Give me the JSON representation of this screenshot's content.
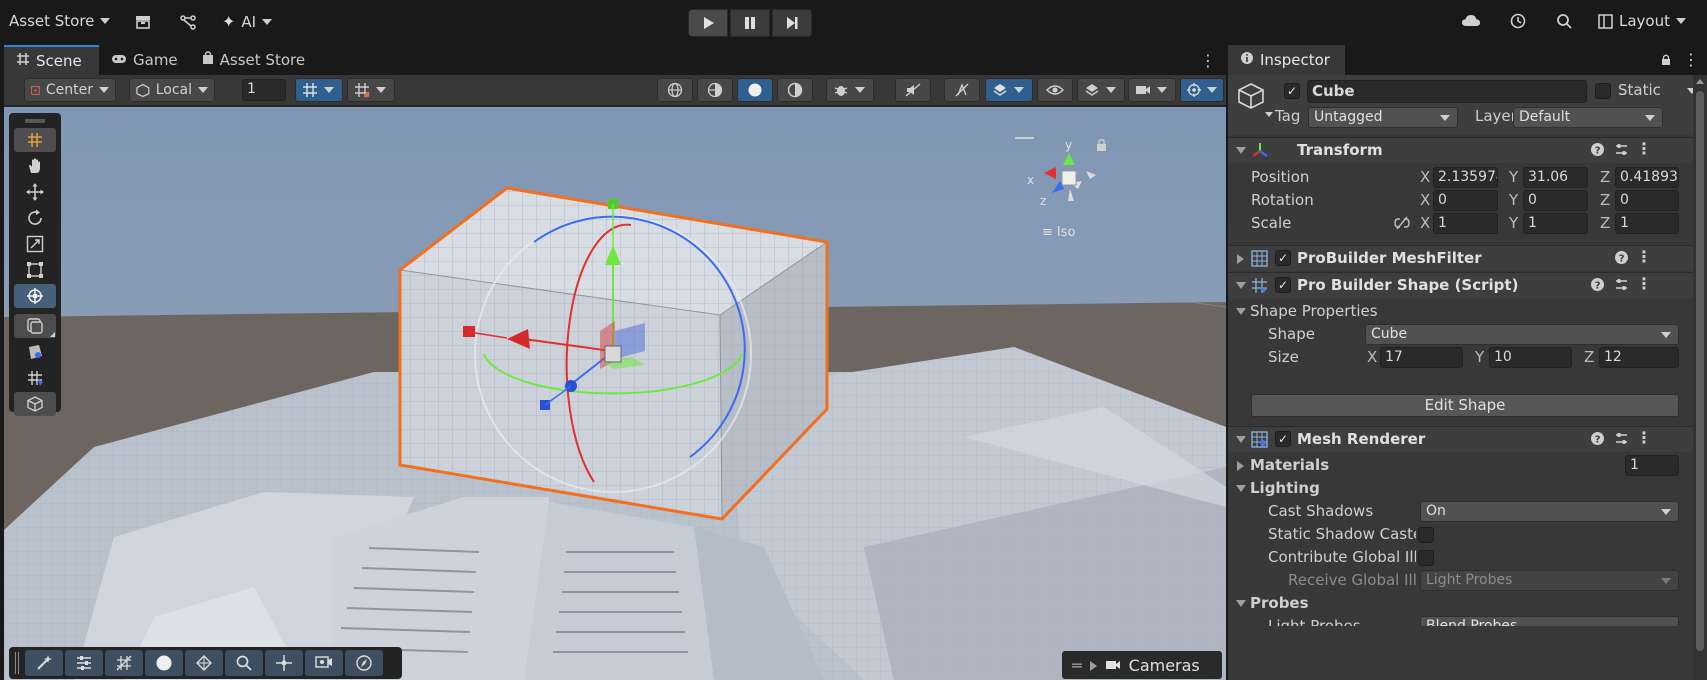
{
  "topbar": {
    "asset_store_menu": "Asset Store",
    "ai_menu": "AI",
    "layout_menu": "Layout"
  },
  "scene_tabs": [
    {
      "label": "Scene"
    },
    {
      "label": "Game"
    },
    {
      "label": "Asset Store"
    }
  ],
  "scene_toolbar": {
    "pivot_mode": "Center",
    "pivot_rotation": "Local",
    "grid_size": "1"
  },
  "viewport": {
    "orientation_label": "Iso",
    "gizmo_axes": {
      "x": "x",
      "y": "y",
      "z": "z"
    },
    "cameras_label": "Cameras"
  },
  "inspector": {
    "tab_label": "Inspector",
    "object_name": "Cube",
    "object_enabled": true,
    "static_label": "Static",
    "static_checked": false,
    "tag_label": "Tag",
    "tag_value": "Untagged",
    "layer_label": "Layer",
    "layer_value": "Default",
    "transform": {
      "title": "Transform",
      "position_label": "Position",
      "rotation_label": "Rotation",
      "scale_label": "Scale",
      "position": {
        "x": "2.135974",
        "y": "31.06",
        "z": "0.41893"
      },
      "rotation": {
        "x": "0",
        "y": "0",
        "z": "0"
      },
      "scale": {
        "x": "1",
        "y": "1",
        "z": "1"
      }
    },
    "mesh_filter": {
      "title": "ProBuilder MeshFilter",
      "enabled": true
    },
    "shape_script": {
      "title": "Pro Builder Shape (Script)",
      "enabled": true,
      "section_label": "Shape Properties",
      "shape_label": "Shape",
      "shape_value": "Cube",
      "size_label": "Size",
      "size": {
        "x": "17",
        "y": "10",
        "z": "12"
      },
      "edit_button": "Edit Shape"
    },
    "mesh_renderer": {
      "title": "Mesh Renderer",
      "enabled": true,
      "materials_label": "Materials",
      "materials_count": "1",
      "lighting_label": "Lighting",
      "cast_shadows_label": "Cast Shadows",
      "cast_shadows_value": "On",
      "static_shadow_label": "Static Shadow Caste",
      "contribute_gi_label": "Contribute Global Illu",
      "receive_gi_label": "Receive Global Illu",
      "receive_gi_value": "Light Probes",
      "probes_label": "Probes",
      "light_probes_label": "Light Probes",
      "light_probes_value": "Blend Probes"
    }
  },
  "colors": {
    "accent": "#3b82d8",
    "selection_outline": "#f07020",
    "gizmo_x": "#e03030",
    "gizmo_y": "#6ee840",
    "gizmo_z": "#3a6cf0"
  }
}
